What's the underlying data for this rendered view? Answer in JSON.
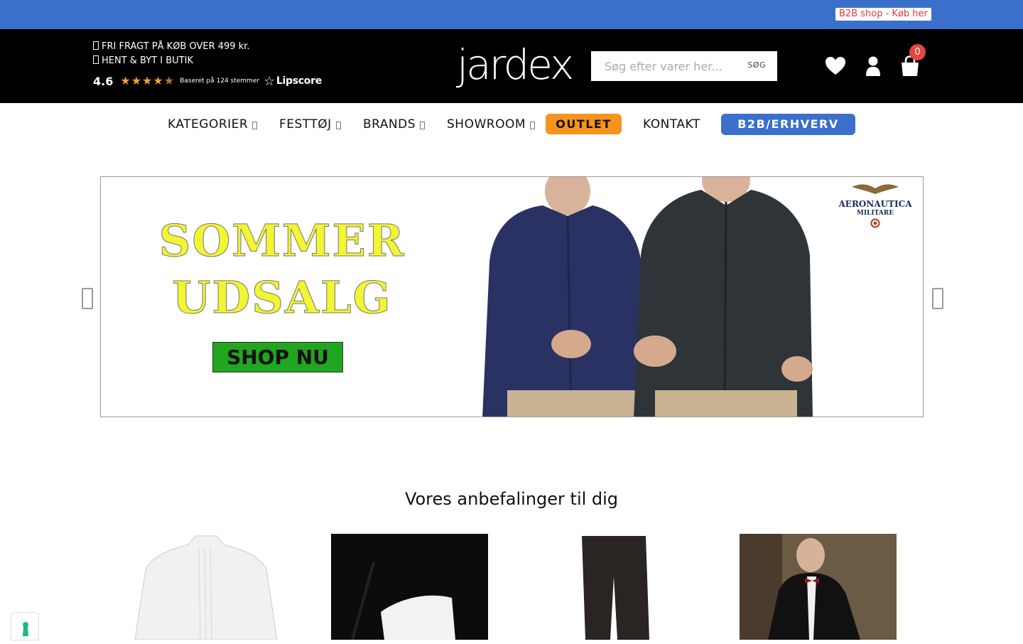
{
  "topbar": {
    "b2b_link": "B2B shop - Køb her"
  },
  "header": {
    "usp": [
      "FRI FRAGT PÅ KØB OVER 499 kr.",
      "HENT & BYT I BUTIK"
    ],
    "rating": {
      "score": "4.6",
      "stars": 4.6,
      "based_on": "Baseret på 124 stemmer",
      "provider": "Lipscore"
    },
    "logo": "jardex",
    "search": {
      "placeholder": "Søg efter varer her...",
      "button": "SØG"
    },
    "cart_count": "0",
    "colors": {
      "header_bg": "#000000",
      "topbar_bg": "#3a6fcc",
      "badge": "#e64540"
    }
  },
  "nav": {
    "items": [
      "KATEGORIER",
      "FESTTØJ",
      "BRANDS",
      "SHOWROOM"
    ],
    "outlet": "OUTLET",
    "contact": "KONTAKT",
    "b2b": "B2B/ERHVERV",
    "colors": {
      "outlet": "#f7931e",
      "b2b": "#3a6fcc"
    }
  },
  "banner": {
    "line1": "SOMMER",
    "line2": "UDSALG",
    "cta": "SHOP NU",
    "brand_name": "AERONAUTICA",
    "brand_sub": "MILITARE"
  },
  "recommendations": {
    "title": "Vores anbefalinger til dig",
    "products": [
      "white-tuxedo-shirt",
      "black-pocket-square",
      "black-trousers",
      "man-in-tuxedo"
    ]
  }
}
